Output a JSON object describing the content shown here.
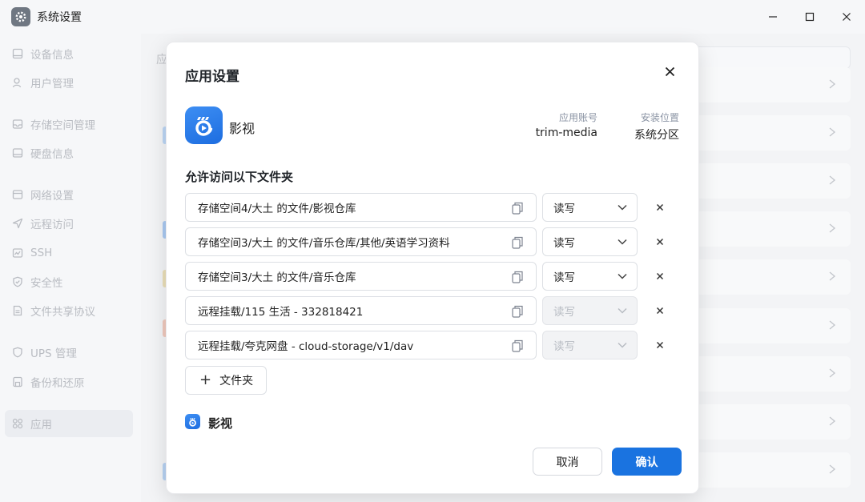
{
  "window": {
    "title": "系统设置",
    "icon": "gear-icon"
  },
  "sidebar": {
    "items": [
      {
        "label": "设备信息",
        "icon": "monitor-icon"
      },
      {
        "label": "用户管理",
        "icon": "user-icon"
      },
      {
        "label": "存储空间管理",
        "icon": "storage-icon"
      },
      {
        "label": "硬盘信息",
        "icon": "disk-icon"
      },
      {
        "label": "网络设置",
        "icon": "network-icon"
      },
      {
        "label": "远程访问",
        "icon": "send-icon"
      },
      {
        "label": "SSH",
        "icon": "terminal-icon"
      },
      {
        "label": "安全性",
        "icon": "shield-icon"
      },
      {
        "label": "文件共享协议",
        "icon": "file-share-icon"
      },
      {
        "label": "UPS 管理",
        "icon": "ups-icon"
      },
      {
        "label": "备份和还原",
        "icon": "backup-icon"
      },
      {
        "label": "应用",
        "icon": "apps-grid-icon",
        "active": true
      }
    ]
  },
  "content": {
    "title_partial": "应"
  },
  "modal": {
    "title": "应用设置",
    "app": {
      "name": "影视",
      "account_label": "应用账号",
      "account_value": "trim-media",
      "location_label": "安装位置",
      "location_value": "系统分区"
    },
    "section_title": "允许访问以下文件夹",
    "folders": [
      {
        "path": "存储空间4/大土 的文件/影视仓库",
        "permission": "读写",
        "disabled": false
      },
      {
        "path": "存储空间3/大土 的文件/音乐仓库/其他/英语学习资料",
        "permission": "读写",
        "disabled": false
      },
      {
        "path": "存储空间3/大土 的文件/音乐仓库",
        "permission": "读写",
        "disabled": false
      },
      {
        "path": "远程挂载/115 生活 - 332818421",
        "permission": "读写",
        "disabled": true
      },
      {
        "path": "远程挂载/夸克网盘 - cloud-storage/v1/dav",
        "permission": "读写",
        "disabled": true
      }
    ],
    "add_folder_label": "文件夹",
    "footer_app_name": "影视",
    "cancel_label": "取消",
    "confirm_label": "确认"
  },
  "colors": {
    "accent": "#1a73e0",
    "app_icon": "#2f80ed"
  }
}
